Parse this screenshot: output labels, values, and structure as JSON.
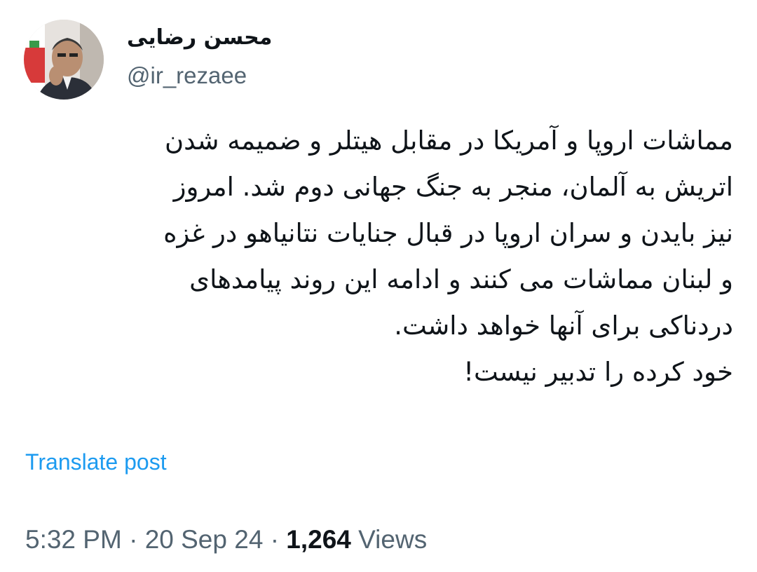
{
  "author": {
    "display_name": "محسن رضایی",
    "handle": "@ir_rezaee"
  },
  "tweet": {
    "lines": [
      "مماشات اروپا و آمریکا در مقابل هیتلر و ضمیمه شدن",
      "اتریش به آلمان، منجر به جنگ جهانی دوم شد. امروز",
      "نیز بایدن و سران اروپا در قبال جنایات نتانیاهو در غزه",
      "و لبنان مماشات می کنند و ادامه این روند پیامدهای",
      "دردناکی برای آنها خواهد داشت.",
      "خود کرده را تدبیر نیست!"
    ]
  },
  "actions": {
    "translate_label": "Translate post"
  },
  "meta": {
    "time": "5:32 PM",
    "separator": "·",
    "date": "20 Sep 24",
    "views_count": "1,264",
    "views_label": "Views"
  },
  "colors": {
    "link": "#1d9bf0",
    "muted": "#536471",
    "text": "#0f1419"
  }
}
